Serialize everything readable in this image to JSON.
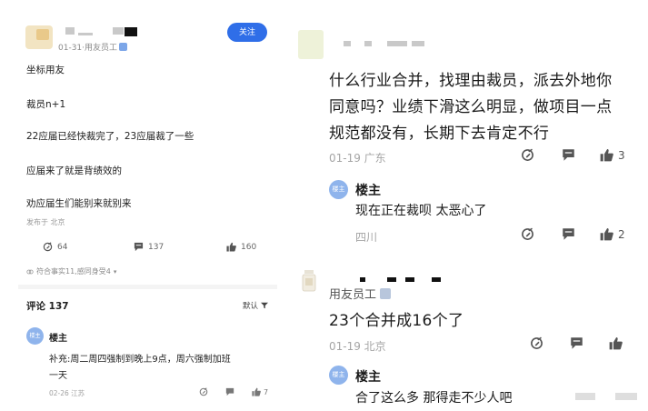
{
  "left": {
    "header": {
      "time": "01-31",
      "role": "用友员工",
      "follow_label": "关注"
    },
    "post_lines": [
      "坐标用友",
      "裁员n+1",
      "22应届已经快裁完了，23应届裁了一些",
      "应届来了就是背绩效的",
      "劝应届生们能别来就别来"
    ],
    "publish_meta": "发布于  北京",
    "actions": {
      "share_count": "64",
      "comment_count": "137",
      "like_count": "160"
    },
    "tags": "符合事实11,感同身受4",
    "comments_title": "评论 137",
    "sort_label": "默认",
    "reply": {
      "avatar_text": "楼主",
      "author": "楼主",
      "text_line1": "补充:周二周四强制到晚上9点，周六强制加班",
      "text_line2": "一天",
      "meta": "02-26  江苏",
      "like_count": "7"
    }
  },
  "right": {
    "comment1": {
      "lines": [
        "什么行业合并，找理由裁员，派去外地你",
        "同意吗？业绩下滑这么明显，做项目一点",
        "规范都没有，长期下去肯定不行"
      ],
      "meta": "01-19  广东",
      "like_count": "3",
      "reply": {
        "avatar_text": "楼主",
        "author": "楼主",
        "text": "现在正在裁呗 太恶心了",
        "location": "四川",
        "like_count": "2"
      }
    },
    "comment2": {
      "user_label": "用友员工",
      "text": "23个合并成16个了",
      "meta": "01-19  北京",
      "reply": {
        "avatar_text": "楼主",
        "author": "楼主",
        "text": "合了这么多 那得走不少人吧"
      }
    }
  },
  "colors": {
    "accent": "#2f6ee8",
    "meta_grey": "#a5a5a5",
    "lz_avatar": "#8fb4ec"
  }
}
